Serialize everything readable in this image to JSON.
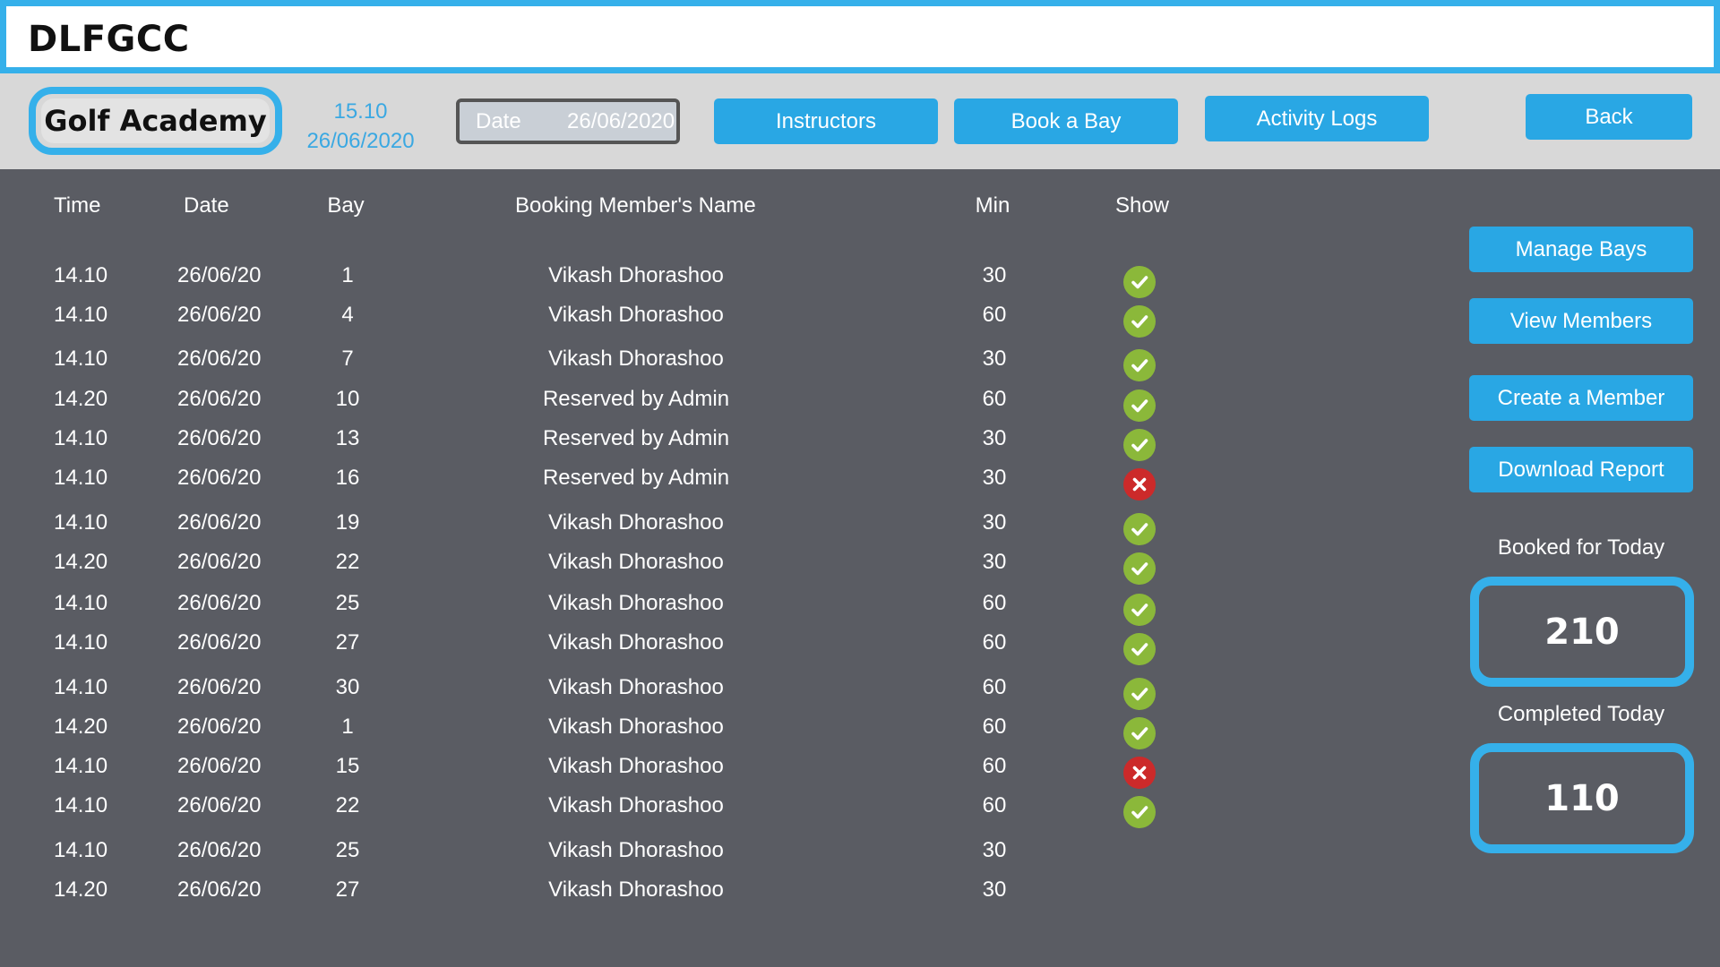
{
  "app": {
    "title": "DLFGCC"
  },
  "toolbar": {
    "academy_label": "Golf Academy",
    "time": "15.10",
    "date": "26/06/2020",
    "date_field_label": "Date",
    "date_field_value": "26/06/2020",
    "instructors_label": "Instructors",
    "book_bay_label": "Book a Bay",
    "activity_logs_label": "Activity Logs",
    "back_label": "Back"
  },
  "table": {
    "headers": {
      "time": "Time",
      "date": "Date",
      "bay": "Bay",
      "booking": "Booking  Member's Name",
      "min": "Min",
      "show": "Show"
    },
    "rows": [
      {
        "time": "14.10",
        "date": "26/06/20",
        "bay": "1",
        "name": "Vikash Dhorashoo",
        "min": "30",
        "show": "check-icon"
      },
      {
        "time": "14.10",
        "date": "26/06/20",
        "bay": "4",
        "name": "Vikash Dhorashoo",
        "min": "60",
        "show": "check-icon"
      },
      {
        "time": "14.10",
        "date": "26/06/20",
        "bay": "7",
        "name": "Vikash Dhorashoo",
        "min": "30",
        "show": "check-icon"
      },
      {
        "time": "14.20",
        "date": "26/06/20",
        "bay": "10",
        "name": "Reserved by Admin",
        "min": "60",
        "show": "check-icon"
      },
      {
        "time": "14.10",
        "date": "26/06/20",
        "bay": "13",
        "name": "Reserved by Admin",
        "min": "30",
        "show": "check-icon"
      },
      {
        "time": "14.10",
        "date": "26/06/20",
        "bay": "16",
        "name": "Reserved by Admin",
        "min": "30",
        "show": "cross-icon"
      },
      {
        "time": "14.10",
        "date": "26/06/20",
        "bay": "19",
        "name": "Vikash Dhorashoo",
        "min": "30",
        "show": "check-icon"
      },
      {
        "time": "14.20",
        "date": "26/06/20",
        "bay": "22",
        "name": "Vikash Dhorashoo",
        "min": "30",
        "show": "check-icon"
      },
      {
        "time": "14.10",
        "date": "26/06/20",
        "bay": "25",
        "name": "Vikash Dhorashoo",
        "min": "60",
        "show": "check-icon"
      },
      {
        "time": "14.10",
        "date": "26/06/20",
        "bay": "27",
        "name": "Vikash Dhorashoo",
        "min": "60",
        "show": "check-icon"
      },
      {
        "time": "14.10",
        "date": "26/06/20",
        "bay": "30",
        "name": "Vikash Dhorashoo",
        "min": "60",
        "show": "check-icon"
      },
      {
        "time": "14.20",
        "date": "26/06/20",
        "bay": "1",
        "name": "Vikash Dhorashoo",
        "min": "60",
        "show": "check-icon"
      },
      {
        "time": "14.10",
        "date": "26/06/20",
        "bay": "15",
        "name": "Vikash Dhorashoo",
        "min": "60",
        "show": "cross-icon"
      },
      {
        "time": "14.10",
        "date": "26/06/20",
        "bay": "22",
        "name": "Vikash Dhorashoo",
        "min": "60",
        "show": "check-icon"
      },
      {
        "time": "14.10",
        "date": "26/06/20",
        "bay": "25",
        "name": "Vikash Dhorashoo",
        "min": "30",
        "show": ""
      },
      {
        "time": "14.20",
        "date": "26/06/20",
        "bay": "27",
        "name": "Vikash Dhorashoo",
        "min": "30",
        "show": ""
      }
    ]
  },
  "side": {
    "manage_bays_label": "Manage Bays",
    "view_members_label": "View Members",
    "create_member_label": "Create a Member",
    "download_report_label": "Download Report",
    "booked_label": "Booked for Today",
    "booked_value": "210",
    "completed_label": "Completed Today",
    "completed_value": "110"
  },
  "colors": {
    "accent": "#35b0ea",
    "button": "#29a7e4",
    "background": "#5a5c63",
    "toolbar": "#d8d8d8",
    "check": "#8bb83a",
    "cross": "#cc2a2a"
  }
}
